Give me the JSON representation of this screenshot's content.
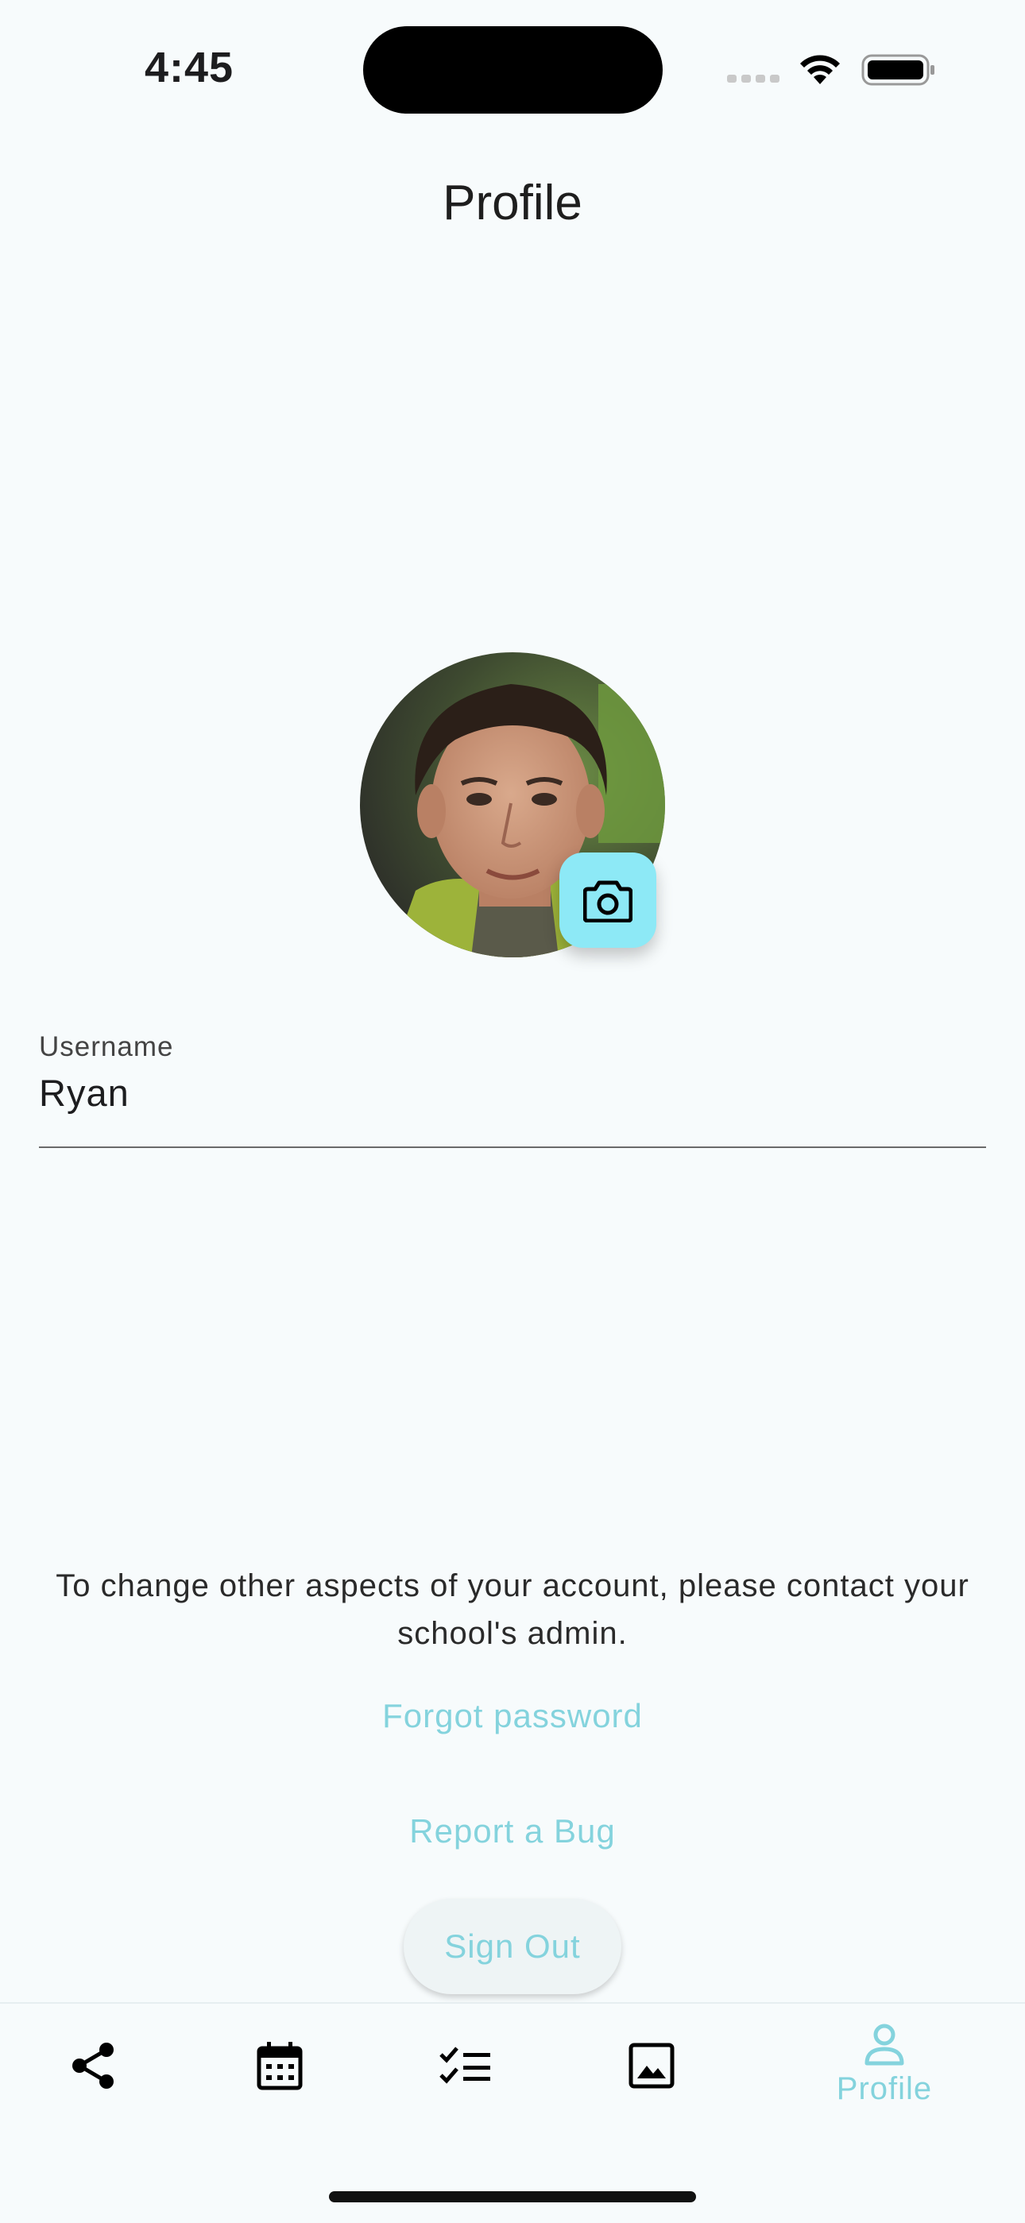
{
  "status_bar": {
    "time": "4:45"
  },
  "header": {
    "title": "Profile"
  },
  "profile": {
    "avatar_icon": "user-photo",
    "change_photo_icon": "camera-icon"
  },
  "username_field": {
    "label": "Username",
    "value": "Ryan"
  },
  "info": {
    "message": "To change other aspects of your account, please contact your school's admin."
  },
  "actions": {
    "forgot_password": "Forgot password",
    "report_bug": "Report a Bug",
    "sign_out": "Sign Out"
  },
  "bottom_nav": {
    "items": [
      {
        "icon": "share-icon",
        "label": ""
      },
      {
        "icon": "calendar-icon",
        "label": ""
      },
      {
        "icon": "checklist-icon",
        "label": ""
      },
      {
        "icon": "image-icon",
        "label": ""
      },
      {
        "icon": "person-icon",
        "label": "Profile",
        "active": true
      }
    ]
  },
  "colors": {
    "accent": "#84d3dd",
    "camera_button": "#8de9f6",
    "background": "#f7fbfc"
  }
}
